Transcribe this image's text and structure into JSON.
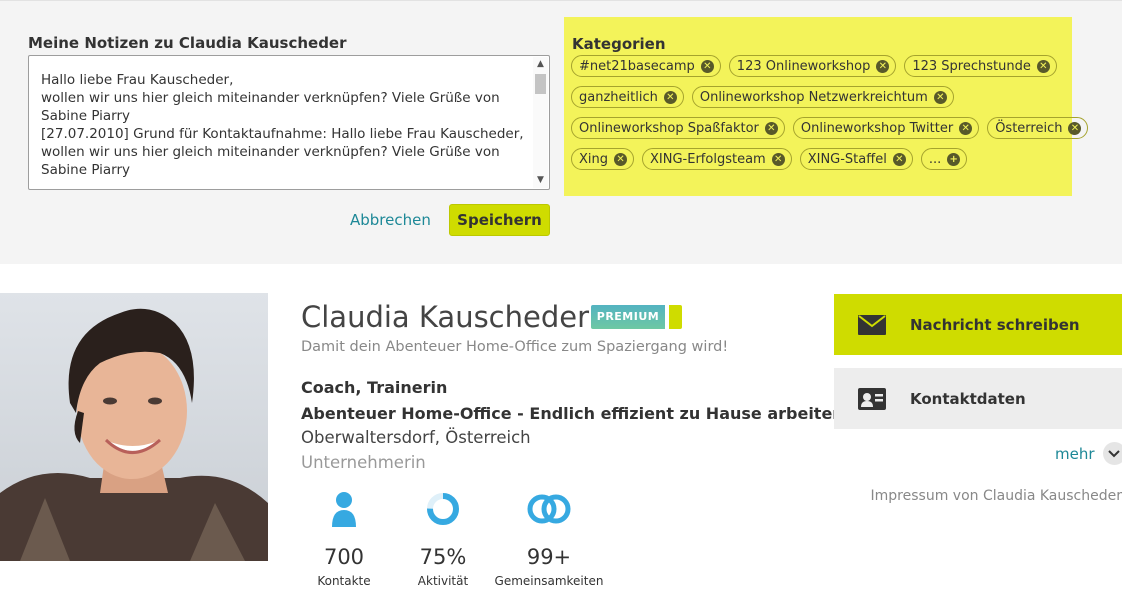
{
  "notes": {
    "title": "Meine Notizen zu Claudia Kauscheder",
    "text": "Hallo liebe Frau Kauscheder,\nwollen wir uns hier gleich miteinander verknüpfen? Viele Grüße von\nSabine Piarry\n[27.07.2010] Grund für Kontaktaufnahme: Hallo liebe Frau Kauscheder,\nwollen wir uns hier gleich miteinander verknüpfen? Viele Grüße von\nSabine Piarry",
    "cancel_label": "Abbrechen",
    "save_label": "Speichern"
  },
  "categories": {
    "title": "Kategorien",
    "highlight_color": "#f3f35a",
    "rows": [
      [
        "#net21basecamp",
        "123 Onlineworkshop",
        "123 Sprechstunde"
      ],
      [
        "ganzheitlich",
        "Onlineworkshop Netzwerkreichtum"
      ],
      [
        "Onlineworkshop Spaßfaktor",
        "Onlineworkshop Twitter",
        "Österreich"
      ],
      [
        "Xing",
        "XING-Erfolgsteam",
        "XING-Staffel"
      ]
    ],
    "more_label": "...",
    "remove_icon": "close-circle-icon",
    "add_icon": "plus-circle-icon"
  },
  "profile": {
    "name": "Claudia Kauscheder",
    "badge": "PREMIUM",
    "tagline": "Damit dein Abenteuer Home-Office zum Spaziergang wird!",
    "job_title": "Coach, Trainerin",
    "company": "Abenteuer Home-Office - Endlich effizient zu Hause arbeiten!",
    "location": "Oberwaltersdorf, Österreich",
    "role": "Unternehmerin"
  },
  "stats": [
    {
      "icon": "person-icon",
      "value": "700",
      "label": "Kontakte"
    },
    {
      "icon": "activity-ring-icon",
      "value": "75%",
      "label": "Aktivität",
      "fill": 0.75
    },
    {
      "icon": "overlap-rings-icon",
      "value": "99+",
      "label": "Gemeinsamkeiten"
    }
  ],
  "actions": {
    "message_label": "Nachricht schreiben",
    "contact_label": "Kontaktdaten",
    "more_label": "mehr",
    "imprint_label": "Impressum von Claudia Kauscheder"
  },
  "colors": {
    "accent_lime": "#cfdc00",
    "link_teal": "#1d8897",
    "icon_blue": "#36a9e1"
  }
}
